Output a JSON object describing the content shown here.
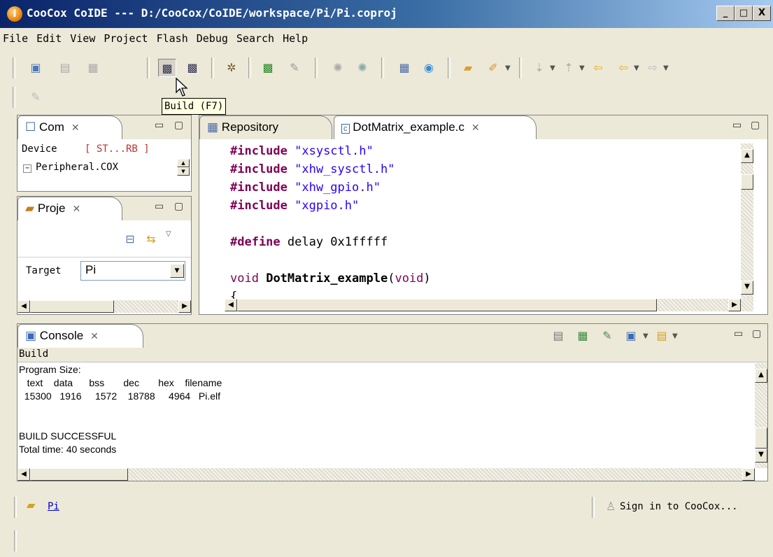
{
  "window": {
    "title": "CooCox CoIDE --- D:/CooCox/CoIDE/workspace/Pi/Pi.coproj",
    "app_icon_letter": "I",
    "controls": {
      "minimize": "_",
      "maximize": "□",
      "close": "X"
    }
  },
  "menu": [
    "File",
    "Edit",
    "View",
    "Project",
    "Flash",
    "Debug",
    "Search",
    "Help"
  ],
  "tooltip": "Build (F7)",
  "components_view": {
    "tab": "Com",
    "device_label": "Device",
    "device_value": "[ ST...RB ]",
    "tree_item": "Peripheral.COX"
  },
  "project_view": {
    "tab": "Proje",
    "target_label": "Target",
    "target_value": "Pi"
  },
  "editor": {
    "tabs": [
      "Repository",
      "DotMatrix_example.c"
    ],
    "lines": [
      {
        "kw": "#include",
        "rest": " \"xsysctl.h\""
      },
      {
        "kw": "#include",
        "rest": " \"xhw_sysctl.h\""
      },
      {
        "kw": "#include",
        "rest": " \"xhw_gpio.h\""
      },
      {
        "kw": "#include",
        "rest": " \"xgpio.h\""
      },
      {
        "kw": "#define",
        "rest": " delay 0x1fffff"
      },
      {
        "kw": "void",
        "name": "DotMatrix_example",
        "paren_open": "(",
        "param": "void",
        "paren_close": ")"
      },
      {
        "text": "{"
      }
    ]
  },
  "console": {
    "tab": "Console",
    "header": "Build",
    "lines": [
      "Program Size:",
      "   text    data      bss       dec       hex    filename",
      "  15300   1916     1572    18788     4964   Pi.elf",
      "",
      "BUILD SUCCESSFUL",
      "Total time: 40 seconds"
    ]
  },
  "status": {
    "project_link": "Pi",
    "sign_in": "Sign in to CooCox..."
  },
  "colors": {
    "titlebar_start": "#0a246a",
    "titlebar_end": "#a6caf0",
    "keyword": "#7f0055",
    "string": "#2a00ff"
  }
}
